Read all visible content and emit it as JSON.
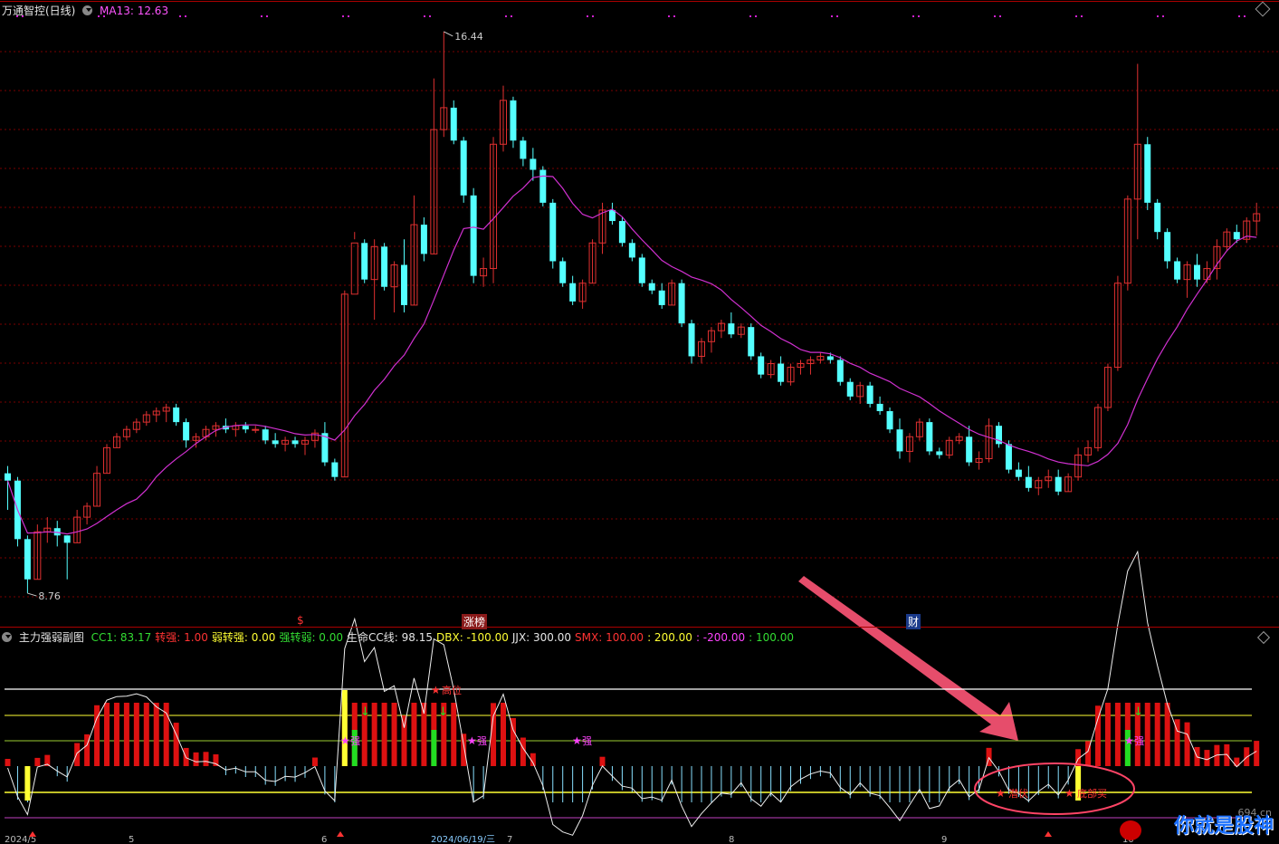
{
  "header": {
    "title": "万通智控(日线)",
    "ma_label": "MA13: 12.63"
  },
  "price_labels": {
    "high": "16.44",
    "low": "8.76"
  },
  "event_tags": {
    "s_mark": "$",
    "zhangting": "涨榜",
    "cai": "财"
  },
  "sub_header": {
    "name": "主力强弱副图",
    "items": [
      {
        "text": "CC1: 83.17",
        "color": "green"
      },
      {
        "text": "转强: 1.00",
        "color": "red"
      },
      {
        "text": "弱转强: 0.00",
        "color": "yellow"
      },
      {
        "text": "强转弱: 0.00",
        "color": "green"
      },
      {
        "text": "生命CC线: 98.15",
        "color": "white"
      },
      {
        "text": "DBX: -100.00",
        "color": "yellow"
      },
      {
        "text": "JJX: 300.00",
        "color": "white"
      },
      {
        "text": "SMX: 100.00",
        "color": "red"
      },
      {
        "text": ": 200.00",
        "color": "yellow"
      },
      {
        "text": ": -200.00",
        "color": "pink"
      },
      {
        "text": ": 100.00",
        "color": "green"
      }
    ]
  },
  "annotations": {
    "high_pos": "高位",
    "qiang": "强",
    "qian_bu": "潜伏",
    "ding_cao": "底部买"
  },
  "date_axis": [
    "2024/5",
    "5",
    "6",
    "2024/06/19/三",
    "7",
    "8",
    "9",
    "10"
  ],
  "watermark": {
    "site": "694.cn",
    "text": "你就是股神"
  },
  "colors": {
    "up": "#e03030",
    "down": "#54ffff",
    "ma_line": "#d030d0",
    "grid": "#7a0000"
  },
  "chart_data": {
    "type": "candlestick",
    "title": "万通智控(日线)",
    "ma13_last": 12.63,
    "price_high": 16.44,
    "price_low": 8.76,
    "candles": [
      [
        10.4,
        10.5,
        9.9,
        10.3
      ],
      [
        10.3,
        10.35,
        9.4,
        9.5
      ],
      [
        9.5,
        9.55,
        8.76,
        8.95
      ],
      [
        8.95,
        9.7,
        8.95,
        9.6
      ],
      [
        9.6,
        9.8,
        9.45,
        9.65
      ],
      [
        9.65,
        9.75,
        9.4,
        9.55
      ],
      [
        9.55,
        9.55,
        8.95,
        9.45
      ],
      [
        9.45,
        9.9,
        9.45,
        9.8
      ],
      [
        9.8,
        10.0,
        9.7,
        9.95
      ],
      [
        9.95,
        10.5,
        9.95,
        10.4
      ],
      [
        10.4,
        10.8,
        10.4,
        10.75
      ],
      [
        10.75,
        10.95,
        10.75,
        10.9
      ],
      [
        10.9,
        11.05,
        10.85,
        11.0
      ],
      [
        11.0,
        11.15,
        10.95,
        11.1
      ],
      [
        11.1,
        11.25,
        11.05,
        11.2
      ],
      [
        11.2,
        11.3,
        11.1,
        11.25
      ],
      [
        11.25,
        11.35,
        11.1,
        11.3
      ],
      [
        11.3,
        11.35,
        11.05,
        11.1
      ],
      [
        11.1,
        11.15,
        10.75,
        10.85
      ],
      [
        10.85,
        10.95,
        10.75,
        10.9
      ],
      [
        10.9,
        11.05,
        10.85,
        11.0
      ],
      [
        11.0,
        11.1,
        10.9,
        11.05
      ],
      [
        11.05,
        11.15,
        10.95,
        11.0
      ],
      [
        11.0,
        11.1,
        10.9,
        11.05
      ],
      [
        11.05,
        11.1,
        10.95,
        11.0
      ],
      [
        11.0,
        11.05,
        10.95,
        11.0
      ],
      [
        11.0,
        11.05,
        10.8,
        10.85
      ],
      [
        10.85,
        10.95,
        10.75,
        10.8
      ],
      [
        10.8,
        10.9,
        10.7,
        10.85
      ],
      [
        10.85,
        10.9,
        10.75,
        10.8
      ],
      [
        10.8,
        10.9,
        10.65,
        10.85
      ],
      [
        10.85,
        11.0,
        10.75,
        10.95
      ],
      [
        10.95,
        11.1,
        10.5,
        10.55
      ],
      [
        10.55,
        10.6,
        10.3,
        10.35
      ],
      [
        10.35,
        12.9,
        10.35,
        12.85
      ],
      [
        12.85,
        13.7,
        13.6,
        13.55
      ],
      [
        13.55,
        13.6,
        13.0,
        13.05
      ],
      [
        13.05,
        13.6,
        12.5,
        13.5
      ],
      [
        13.5,
        13.55,
        12.9,
        12.95
      ],
      [
        12.95,
        13.3,
        12.6,
        13.25
      ],
      [
        13.25,
        13.6,
        12.6,
        12.7
      ],
      [
        12.7,
        14.2,
        12.7,
        13.8
      ],
      [
        13.8,
        13.9,
        13.3,
        13.4
      ],
      [
        13.4,
        15.8,
        13.4,
        15.1
      ],
      [
        15.1,
        16.44,
        15.0,
        15.4
      ],
      [
        15.4,
        15.5,
        14.9,
        14.95
      ],
      [
        14.95,
        15.0,
        14.1,
        14.2
      ],
      [
        14.2,
        14.3,
        13.0,
        13.1
      ],
      [
        13.1,
        13.35,
        12.95,
        13.2
      ],
      [
        13.2,
        15.0,
        13.0,
        14.9
      ],
      [
        14.9,
        15.7,
        14.8,
        15.5
      ],
      [
        15.5,
        15.55,
        14.85,
        14.95
      ],
      [
        14.95,
        15.0,
        14.6,
        14.7
      ],
      [
        14.7,
        14.85,
        14.4,
        14.55
      ],
      [
        14.55,
        14.6,
        14.05,
        14.1
      ],
      [
        14.1,
        14.15,
        13.2,
        13.3
      ],
      [
        13.3,
        13.35,
        12.95,
        13.0
      ],
      [
        13.0,
        13.1,
        12.7,
        12.75
      ],
      [
        12.75,
        13.05,
        12.65,
        13.0
      ],
      [
        13.0,
        13.6,
        13.0,
        13.55
      ],
      [
        13.55,
        14.1,
        13.4,
        14.0
      ],
      [
        14.0,
        14.1,
        13.8,
        13.85
      ],
      [
        13.85,
        13.9,
        13.5,
        13.55
      ],
      [
        13.55,
        13.6,
        13.3,
        13.35
      ],
      [
        13.35,
        13.4,
        12.95,
        13.0
      ],
      [
        13.0,
        13.05,
        12.85,
        12.9
      ],
      [
        12.9,
        13.0,
        12.65,
        12.7
      ],
      [
        12.7,
        13.05,
        12.7,
        13.0
      ],
      [
        13.0,
        13.05,
        12.4,
        12.45
      ],
      [
        12.45,
        12.5,
        11.9,
        12.0
      ],
      [
        12.0,
        12.25,
        11.9,
        12.2
      ],
      [
        12.2,
        12.4,
        12.05,
        12.35
      ],
      [
        12.35,
        12.5,
        12.25,
        12.45
      ],
      [
        12.45,
        12.6,
        12.25,
        12.3
      ],
      [
        12.3,
        12.45,
        12.25,
        12.4
      ],
      [
        12.4,
        12.45,
        11.95,
        12.0
      ],
      [
        12.0,
        12.05,
        11.7,
        11.75
      ],
      [
        11.75,
        11.95,
        11.7,
        11.9
      ],
      [
        11.9,
        12.0,
        11.6,
        11.65
      ],
      [
        11.65,
        11.9,
        11.6,
        11.85
      ],
      [
        11.85,
        11.95,
        11.75,
        11.9
      ],
      [
        11.9,
        12.0,
        11.75,
        11.95
      ],
      [
        11.95,
        12.05,
        11.9,
        12.0
      ],
      [
        12.0,
        12.05,
        11.9,
        11.95
      ],
      [
        11.95,
        12.0,
        11.6,
        11.65
      ],
      [
        11.65,
        11.7,
        11.4,
        11.45
      ],
      [
        11.45,
        11.65,
        11.35,
        11.6
      ],
      [
        11.6,
        11.65,
        11.3,
        11.35
      ],
      [
        11.35,
        11.45,
        11.2,
        11.25
      ],
      [
        11.25,
        11.3,
        10.95,
        11.0
      ],
      [
        11.0,
        11.15,
        10.6,
        10.7
      ],
      [
        10.7,
        10.95,
        10.55,
        10.9
      ],
      [
        10.9,
        11.15,
        10.85,
        11.1
      ],
      [
        11.1,
        11.15,
        10.65,
        10.7
      ],
      [
        10.7,
        10.75,
        10.6,
        10.65
      ],
      [
        10.65,
        10.9,
        10.6,
        10.85
      ],
      [
        10.85,
        10.95,
        10.8,
        10.9
      ],
      [
        10.9,
        11.05,
        10.5,
        10.55
      ],
      [
        10.55,
        10.7,
        10.45,
        10.6
      ],
      [
        10.6,
        11.15,
        10.55,
        11.05
      ],
      [
        11.05,
        11.1,
        10.75,
        10.8
      ],
      [
        10.8,
        10.85,
        10.4,
        10.45
      ],
      [
        10.45,
        10.55,
        10.3,
        10.35
      ],
      [
        10.35,
        10.5,
        10.15,
        10.2
      ],
      [
        10.2,
        10.35,
        10.1,
        10.3
      ],
      [
        10.3,
        10.45,
        10.2,
        10.35
      ],
      [
        10.35,
        10.45,
        10.1,
        10.15
      ],
      [
        10.15,
        10.4,
        10.15,
        10.35
      ],
      [
        10.35,
        10.75,
        10.3,
        10.65
      ],
      [
        10.65,
        10.85,
        10.55,
        10.75
      ],
      [
        10.75,
        11.35,
        10.7,
        11.3
      ],
      [
        11.3,
        11.9,
        11.25,
        11.85
      ],
      [
        11.85,
        13.1,
        11.8,
        13.0
      ],
      [
        13.0,
        14.2,
        12.9,
        14.15
      ],
      [
        14.15,
        16.0,
        13.6,
        14.9
      ],
      [
        14.9,
        15.0,
        14.0,
        14.1
      ],
      [
        14.1,
        14.15,
        13.6,
        13.7
      ],
      [
        13.7,
        13.75,
        13.2,
        13.3
      ],
      [
        13.3,
        13.35,
        13.0,
        13.05
      ],
      [
        13.05,
        13.3,
        12.8,
        13.25
      ],
      [
        13.25,
        13.4,
        12.95,
        13.05
      ],
      [
        13.05,
        13.3,
        13.0,
        13.2
      ],
      [
        13.2,
        13.6,
        13.05,
        13.5
      ],
      [
        13.5,
        13.75,
        13.45,
        13.7
      ],
      [
        13.7,
        13.8,
        13.55,
        13.6
      ],
      [
        13.6,
        13.9,
        13.55,
        13.85
      ],
      [
        13.85,
        14.1,
        13.65,
        13.95
      ]
    ]
  }
}
